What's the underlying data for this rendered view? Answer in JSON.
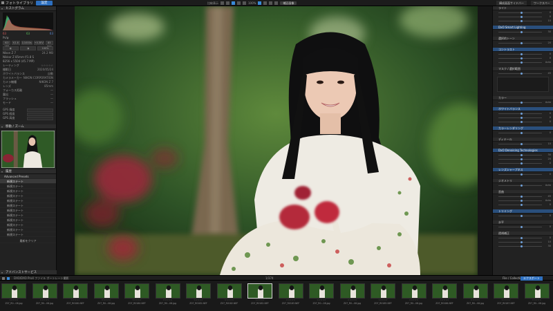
{
  "topbar": {
    "library_title": "フォトライブラリ",
    "settings_tab": "設定",
    "mode_label": "比較表示",
    "zoom_label": "100%",
    "tool_button": "補正画像",
    "right_tab_1": "構成画面サイドバー",
    "right_tab_2": "ワークスペース"
  },
  "left_panel": {
    "histogram_title": "ヒストグラム",
    "histogram_values": [
      "63",
      "63",
      "63"
    ],
    "info_rows": [
      {
        "label": "Ps/ψ",
        "value": ""
      },
      {
        "label": "Nikon Z 7",
        "value": "24.2 MB"
      },
      {
        "label": "Nikkor Z 85mm f/1.8 S",
        "value": ""
      },
      {
        "label": "8256 x 5504 (45.7 MP)",
        "value": ""
      }
    ],
    "buttons_1": [
      "ISO 160",
      "f/1.8",
      "1/1000s",
      "+0.3EV",
      "85 mm"
    ],
    "buttons_2": [
      "◐",
      "◑",
      "100%"
    ],
    "meta_rows": [
      {
        "label": "レーティング",
        "value": "☆☆☆☆☆"
      },
      {
        "label": "撮影日",
        "value": "2020/05/24"
      },
      {
        "label": "ホワイトバランス",
        "value": "自動"
      },
      {
        "label": "カメラメーカー",
        "value": "NIKON CORPORATION"
      },
      {
        "label": "カメラ機種",
        "value": "NIKON Z 7"
      },
      {
        "label": "レンズ",
        "value": "85mm"
      },
      {
        "label": "フォーカス距離",
        "value": "—"
      },
      {
        "label": "露出",
        "value": "—"
      },
      {
        "label": "フラッシュ",
        "value": "—"
      },
      {
        "label": "モード",
        "value": "—"
      }
    ],
    "gps_rows": [
      {
        "label": "GPS 緯度"
      },
      {
        "label": "GPS 経度"
      },
      {
        "label": "GPS 高度"
      }
    ],
    "navigator_title": "移動 / ズーム",
    "presets_title": "履歴",
    "preset_group": "Advanced Presets",
    "preset_items": [
      "新規ステート",
      "新規ステート",
      "新規ステート",
      "新規ステート",
      "新規ステート",
      "新規ステート",
      "新規ステート",
      "新規ステート",
      "新規ステート",
      "新規ステート",
      "新規ステート",
      "新規ステート"
    ],
    "apply_button": "最新をクリア",
    "bottom_title": "アドバンストサービス"
  },
  "right_panel": {
    "sections": [
      {
        "title": "ライト",
        "blue": false
      },
      {
        "title": "DxO Smart Lighting",
        "blue": true
      },
      {
        "title": "選択的トーン",
        "blue": false
      },
      {
        "title": "コントラスト",
        "blue": true
      },
      {
        "title": "マスク / 選択範囲",
        "blue": false
      },
      {
        "title": "カラー",
        "blue": false
      },
      {
        "title": "ホワイトバランス",
        "blue": true
      },
      {
        "title": "カラーレンダリング",
        "blue": true
      },
      {
        "title": "ディテール",
        "blue": false
      },
      {
        "title": "DxO Denoising Technologies",
        "blue": true
      },
      {
        "title": "レンズシャープネス",
        "blue": true
      },
      {
        "title": "ジオメトリ",
        "blue": false
      },
      {
        "title": "歪曲",
        "blue": false
      },
      {
        "title": "トリミング",
        "blue": true
      },
      {
        "title": "水平",
        "blue": false
      },
      {
        "title": "透視補正",
        "blue": false
      }
    ],
    "slider_values": [
      "0",
      "0",
      "10",
      "30",
      "20",
      "0",
      "0",
      "Auto",
      "45",
      "Auto",
      "0",
      "0"
    ]
  },
  "filmbar": {
    "path": "DXO/DXO Pro4 ファイル ポートレート撮影",
    "count": "1/374",
    "filter_label": "File / Collection",
    "export_button": "エクスポート"
  },
  "filmstrip": [
    {
      "name": "Z07_R0...08.jpg",
      "selected": false
    },
    {
      "name": "Z07_R0...08.jpg",
      "selected": false
    },
    {
      "name": "Z07_R0180.NEF",
      "selected": false
    },
    {
      "name": "Z07_R0...08.jpg",
      "selected": false
    },
    {
      "name": "Z07_R0180.NEF",
      "selected": false
    },
    {
      "name": "Z07_R0...08.jpg",
      "selected": false
    },
    {
      "name": "Z07_R0182.NEF",
      "selected": false
    },
    {
      "name": "Z07_R0182.NEF",
      "selected": false
    },
    {
      "name": "Z07_R0182.NEF",
      "selected": true
    },
    {
      "name": "Z07_R0183.NEF",
      "selected": false
    },
    {
      "name": "Z07_R0...08.jpg",
      "selected": false
    },
    {
      "name": "Z07_R0...08.jpg",
      "selected": false
    },
    {
      "name": "Z07_R0185.NEF",
      "selected": false
    },
    {
      "name": "Z07_R0...08.jpg",
      "selected": false
    },
    {
      "name": "Z07_R0186.NEF",
      "selected": false
    },
    {
      "name": "Z07_R0...08.jpg",
      "selected": false
    },
    {
      "name": "Z07_R0187.NEF",
      "selected": false
    },
    {
      "name": "Z07_R0...08.jpg",
      "selected": false
    }
  ],
  "colors": {
    "accent": "#2d6fbf",
    "panel": "#222222",
    "background": "#141414"
  }
}
